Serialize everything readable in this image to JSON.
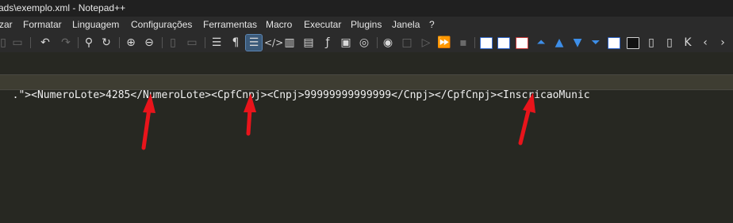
{
  "window": {
    "title": "ads\\exemplo.xml - Notepad++"
  },
  "menu": {
    "items": [
      "zar",
      "Formatar",
      "Linguagem",
      "Configurações",
      "Ferramentas",
      "Macro",
      "Executar",
      "Plugins",
      "Janela",
      "?"
    ]
  },
  "toolbar": {
    "icons": [
      "paste-icon",
      "undo-icon",
      "redo-icon",
      "find-icon",
      "replace-icon",
      "zoom-in-icon",
      "zoom-out-icon",
      "wrap-icon",
      "show-all-chars-icon",
      "indent-guide-icon",
      "xml-tag-icon",
      "doc-map-icon",
      "function-list-icon",
      "monitor-icon",
      "record-macro-icon",
      "stop-macro-icon",
      "play-macro-icon",
      "run-macro-multiple-icon",
      "save-macro-icon"
    ]
  },
  "editor": {
    "line_segments": [
      {
        "kind": "tag",
        "text": ".\">"
      },
      {
        "kind": "tag",
        "text": "<NumeroLote>"
      },
      {
        "kind": "txt",
        "text": "4285"
      },
      {
        "kind": "tag",
        "text": "</NumeroLote>"
      },
      {
        "kind": "tag",
        "text": "<CpfCnpj>"
      },
      {
        "kind": "tag",
        "text": "<Cnpj>"
      },
      {
        "kind": "txt",
        "text": "99999999999999"
      },
      {
        "kind": "tag",
        "text": "</Cnpj>"
      },
      {
        "kind": "tag",
        "text": "</CpfCnpj>"
      },
      {
        "kind": "tag",
        "text": "<InscricaoMunic"
      }
    ]
  },
  "annotations": {
    "arrow_color": "#e8141b"
  }
}
